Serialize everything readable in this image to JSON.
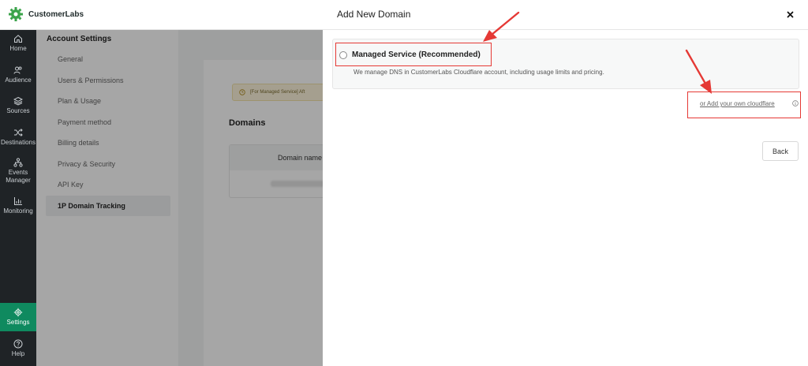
{
  "app": {
    "name": "CustomerLabs"
  },
  "leftnav": {
    "items": [
      {
        "label": "Home",
        "icon": "home-icon"
      },
      {
        "label": "Audience",
        "icon": "audience-icon"
      },
      {
        "label": "Sources",
        "icon": "layers-icon"
      },
      {
        "label": "Destinations",
        "icon": "shuffle-icon"
      },
      {
        "label": "Events Manager",
        "icon": "hierarchy-icon"
      },
      {
        "label": "Monitoring",
        "icon": "chart-icon"
      },
      {
        "label": "Settings",
        "icon": "gear-icon",
        "active": true
      },
      {
        "label": "Help",
        "icon": "help-icon"
      }
    ]
  },
  "settings": {
    "title": "Account Settings",
    "items": [
      {
        "label": "General"
      },
      {
        "label": "Users & Permissions"
      },
      {
        "label": "Plan & Usage"
      },
      {
        "label": "Payment method"
      },
      {
        "label": "Billing details"
      },
      {
        "label": "Privacy & Security"
      },
      {
        "label": "API Key"
      },
      {
        "label": "1P Domain Tracking",
        "active": true
      }
    ]
  },
  "main": {
    "notice": "[For Managed Service] Aft",
    "domains_title": "Domains",
    "table_header": "Domain name"
  },
  "modal": {
    "title": "Add New Domain",
    "option_label": "Managed Service (Recommended)",
    "option_description": "We manage DNS in CustomerLabs Cloudflare account, including usage limits and pricing.",
    "alt_link": "or Add your own cloudflare",
    "back_label": "Back"
  },
  "colors": {
    "brand": "#0f8a5f",
    "annotation": "#e53935",
    "nav_background": "#1f2326"
  }
}
